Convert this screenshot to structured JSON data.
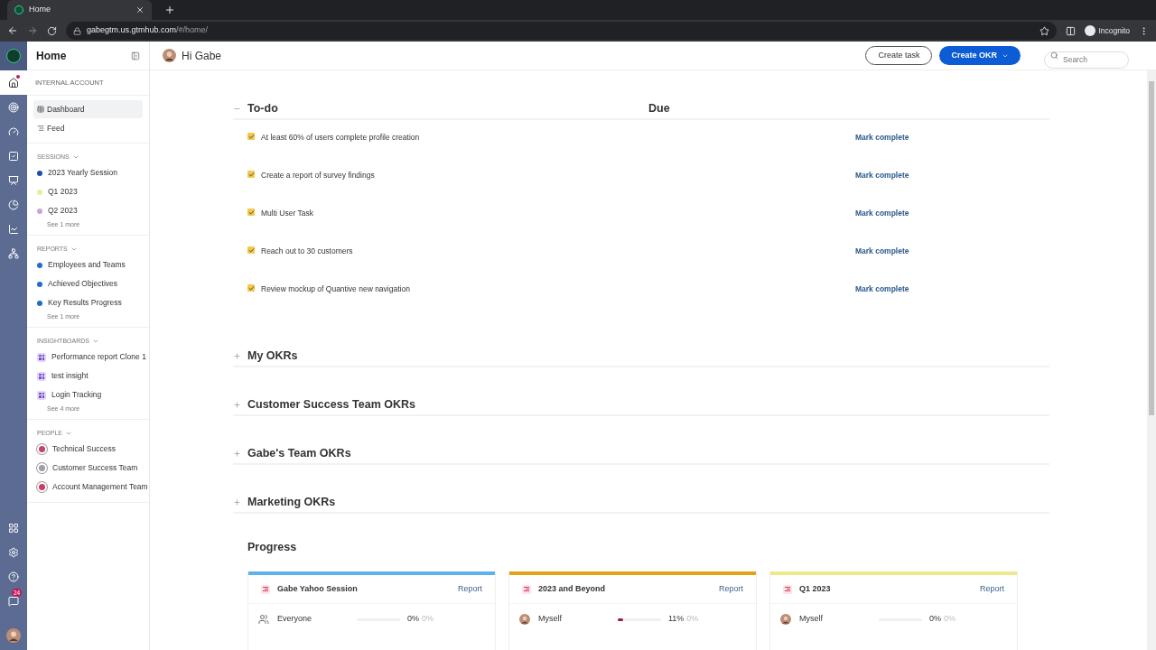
{
  "browser": {
    "tab_title": "Home",
    "url_host": "gabegtm.us.gtmhub.com",
    "url_path": "/#/home/",
    "profile": "Incognito"
  },
  "rail": {
    "items": [
      {
        "kind": "home",
        "selected": true
      },
      {
        "kind": "target",
        "selected": false
      },
      {
        "kind": "gauge",
        "selected": false
      },
      {
        "kind": "tasks",
        "selected": false
      },
      {
        "kind": "board",
        "selected": false
      },
      {
        "kind": "pie",
        "selected": false
      },
      {
        "kind": "chart",
        "selected": false
      },
      {
        "kind": "people",
        "selected": false
      }
    ],
    "notifications": "24"
  },
  "sidebar": {
    "title": "Home",
    "account": "INTERNAL ACCOUNT",
    "nav": [
      {
        "label": "Dashboard",
        "kind": "grid",
        "selected": true
      },
      {
        "label": "Feed",
        "kind": "feed",
        "selected": false
      }
    ],
    "groups": [
      {
        "title": "SESSIONS",
        "items": [
          {
            "label": "2023 Yearly Session",
            "kind": "dot",
            "color": "#1f4fa3"
          },
          {
            "label": "Q1 2023",
            "kind": "dot",
            "color": "#e6ee9c"
          },
          {
            "label": "Q2 2023",
            "kind": "dot",
            "color": "#c8a2d8"
          }
        ],
        "more": "See 1 more"
      },
      {
        "title": "REPORTS",
        "items": [
          {
            "label": "Employees and Teams",
            "kind": "dot",
            "color": "#1f6fc4"
          },
          {
            "label": "Achieved Objectives",
            "kind": "dot",
            "color": "#1f6fc4"
          },
          {
            "label": "Key Results Progress",
            "kind": "dot",
            "color": "#1f6fc4"
          }
        ],
        "more": "See 1 more"
      },
      {
        "title": "INSIGHTBOARDS",
        "items": [
          {
            "label": "Performance report Clone 1",
            "kind": "board"
          },
          {
            "label": "test insight",
            "kind": "board"
          },
          {
            "label": "Login Tracking",
            "kind": "board"
          }
        ],
        "more": "See 4 more"
      },
      {
        "title": "PEOPLE",
        "items": [
          {
            "label": "Technical Success",
            "kind": "team",
            "color": "#c2456b"
          },
          {
            "label": "Customer Success Team",
            "kind": "team",
            "color": "#9aa0a8"
          },
          {
            "label": "Account Management Team",
            "kind": "team",
            "color": "#d33a63"
          }
        ]
      }
    ]
  },
  "header": {
    "greeting": "Hi Gabe",
    "create_task": "Create task",
    "create_okr": "Create OKR",
    "search": {
      "placeholder": "Search"
    }
  },
  "todo": {
    "title": "To-do",
    "expanded": true,
    "due_heading": "Due",
    "items": [
      {
        "label": "At least 60% of users complete profile creation",
        "checked": true,
        "action": "Mark complete"
      },
      {
        "label": "Create a report of survey findings",
        "checked": true,
        "action": "Mark complete"
      },
      {
        "label": "Multi User Task",
        "checked": true,
        "action": "Mark complete"
      },
      {
        "label": "Reach out to 30 customers",
        "checked": true,
        "action": "Mark complete"
      },
      {
        "label": "Review mockup of Quantive new navigation",
        "checked": true,
        "action": "Mark complete"
      }
    ]
  },
  "sections": [
    {
      "title": "My OKRs",
      "expanded": false
    },
    {
      "title": "Customer Success Team OKRs",
      "expanded": false
    },
    {
      "title": "Gabe's Team OKRs",
      "expanded": false
    },
    {
      "title": "Marketing OKRs",
      "expanded": false
    }
  ],
  "progress": {
    "title": "Progress",
    "cards": [
      {
        "title": "Gabe Yahoo Session",
        "color": "#5db3e8",
        "report": "Report",
        "rows": [
          {
            "kind": "group",
            "label": "Everyone",
            "value": "0%",
            "change": "0%"
          }
        ]
      },
      {
        "title": "2023 and Beyond",
        "color": "#e0a416",
        "report": "Report",
        "rows": [
          {
            "kind": "avatar",
            "label": "Myself",
            "level": 0.11,
            "value": "11%",
            "change": "0%"
          }
        ]
      },
      {
        "title": "Q1 2023",
        "color": "#ede98b",
        "report": "Report",
        "rows": [
          {
            "kind": "avatar",
            "label": "Myself",
            "value": "0%",
            "change": "0%"
          }
        ]
      }
    ]
  }
}
